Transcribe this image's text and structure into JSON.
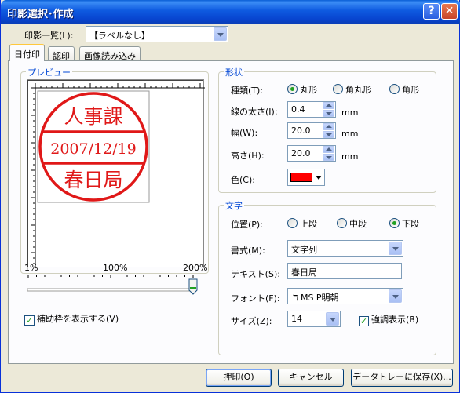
{
  "window": {
    "title": "印影選択･作成"
  },
  "stamp_list": {
    "label": "印影一覧(L):",
    "value": "【ラベルなし】"
  },
  "tabs": [
    {
      "label": "日付印"
    },
    {
      "label": "認印"
    },
    {
      "label": "画像読み込み"
    }
  ],
  "preview": {
    "title": "プレビュー",
    "stamp": {
      "top": "人事課",
      "middle": "2007/12/19",
      "bottom": "春日局",
      "color": "#e01818"
    },
    "zoom_labels": [
      "1%",
      "100%",
      "200%"
    ],
    "zoom_level": 1.0
  },
  "shape": {
    "title": "形状",
    "type_label": "種類(T):",
    "options": [
      "丸形",
      "角丸形",
      "角形"
    ],
    "selected": "丸形",
    "line_width_label": "線の太さ(I):",
    "line_width": "0.4",
    "width_label": "幅(W):",
    "width": "20.0",
    "height_label": "高さ(H):",
    "height": "20.0",
    "unit": "mm",
    "color_label": "色(C):",
    "color": "#ff0000"
  },
  "text": {
    "title": "文字",
    "position_label": "位置(P):",
    "positions": [
      "上段",
      "中段",
      "下段"
    ],
    "selected_position": "下段",
    "format_label": "書式(M):",
    "format": "文字列",
    "text_label": "テキスト(S):",
    "text_value": "春日局",
    "font_label": "フォント(F):",
    "font": "MS P明朝",
    "size_label": "サイズ(Z):",
    "size": "14",
    "bold_label": "強調表示(B)",
    "bold_checked": true
  },
  "show_guides": {
    "label": "補助枠を表示する(V)",
    "checked": true
  },
  "buttons": {
    "ok": "押印(O)",
    "cancel": "キャンセル",
    "save": "データトレーに保存(X)..."
  }
}
